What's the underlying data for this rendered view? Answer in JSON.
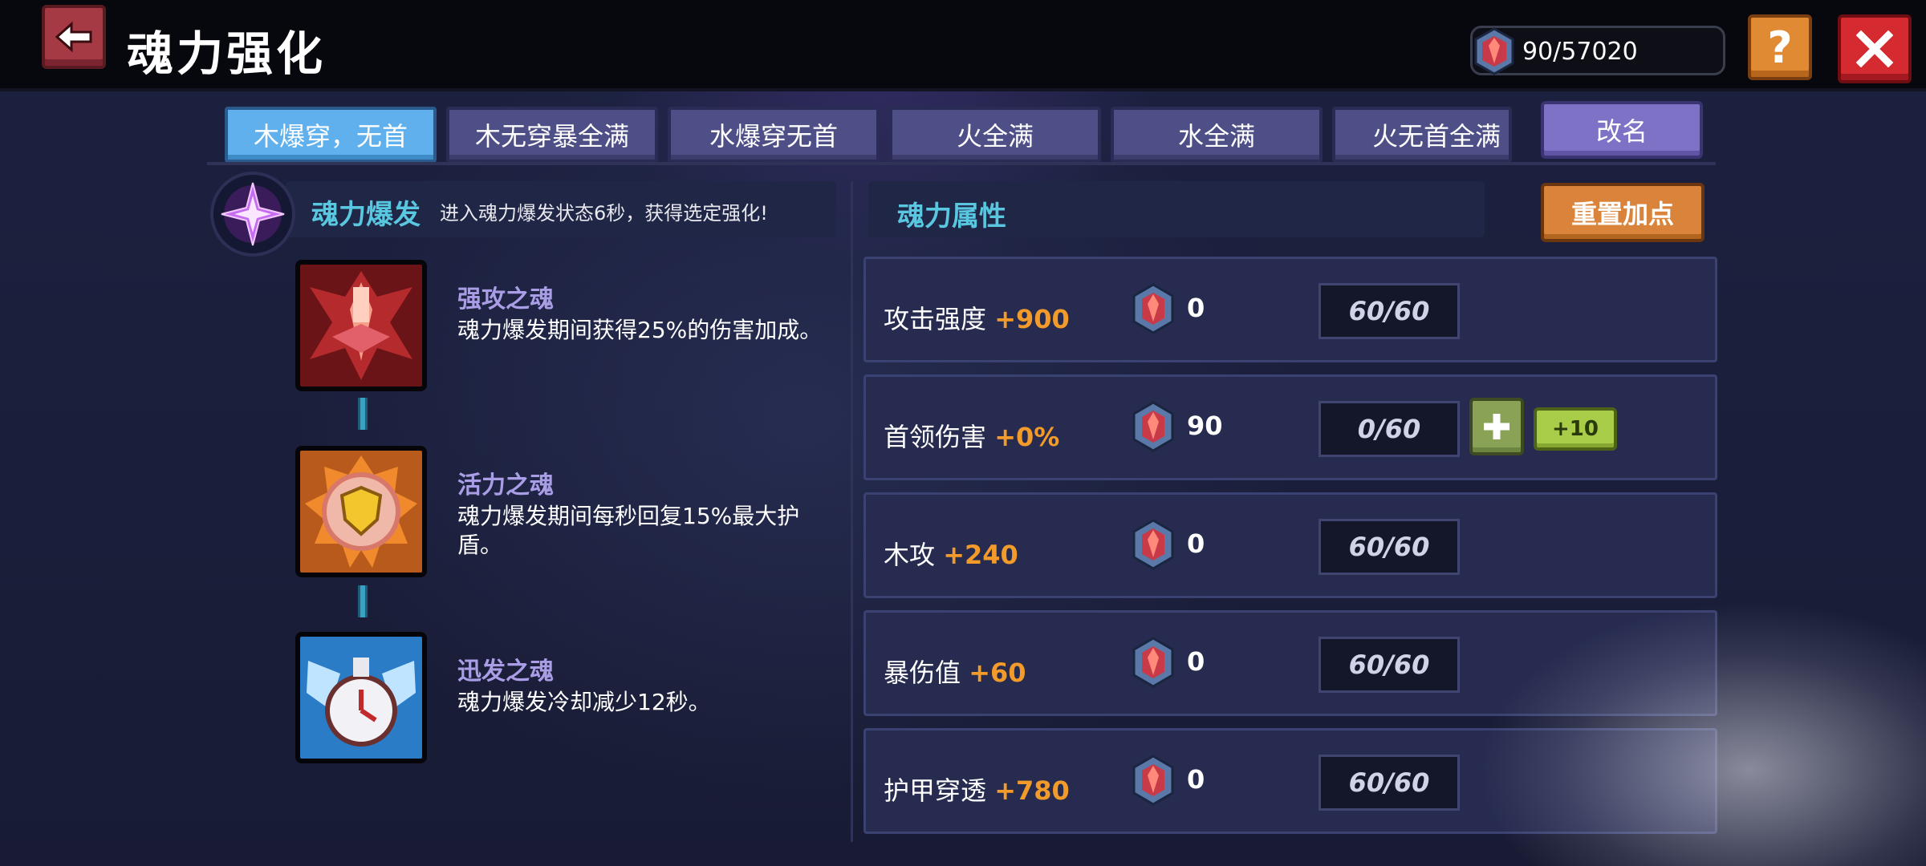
{
  "header": {
    "title": "魂力强化",
    "currency": "90/57020"
  },
  "tabs": [
    {
      "label": "木爆穿，无首",
      "active": true
    },
    {
      "label": "木无穿暴全满",
      "active": false
    },
    {
      "label": "水爆穿无首",
      "active": false
    },
    {
      "label": "火全满",
      "active": false
    },
    {
      "label": "水全满",
      "active": false
    },
    {
      "label": "火无首全满",
      "active": false
    }
  ],
  "rename_label": "改名",
  "burst": {
    "title": "魂力爆发",
    "description": "进入魂力爆发状态6秒，获得选定强化!"
  },
  "souls": [
    {
      "name": "强攻之魂",
      "description": "魂力爆发期间获得25%的伤害加成。",
      "icon": "attack-soul-icon"
    },
    {
      "name": "活力之魂",
      "description": "魂力爆发期间每秒回复15%最大护盾。",
      "icon": "vitality-soul-icon"
    },
    {
      "name": "迅发之魂",
      "description": "魂力爆发冷却减少12秒。",
      "icon": "swift-soul-icon"
    }
  ],
  "attributes": {
    "title": "魂力属性",
    "reset_label": "重置加点",
    "rows": [
      {
        "label": "攻击强度",
        "bonus": "+900",
        "cost": "0",
        "level": "60/60"
      },
      {
        "label": "首领伤害",
        "bonus": "+0%",
        "cost": "90",
        "level": "0/60",
        "plus_label": "+10"
      },
      {
        "label": "木攻",
        "bonus": "+240",
        "cost": "0",
        "level": "60/60"
      },
      {
        "label": "暴伤值",
        "bonus": "+60",
        "cost": "0",
        "level": "60/60"
      },
      {
        "label": "护甲穿透",
        "bonus": "+780",
        "cost": "0",
        "level": "60/60"
      }
    ]
  },
  "colors": {
    "accent_cyan": "#58c7df",
    "bonus_orange": "#f39b2a",
    "active_tab": "#5fb0ec",
    "tab": "#4f4f88"
  }
}
